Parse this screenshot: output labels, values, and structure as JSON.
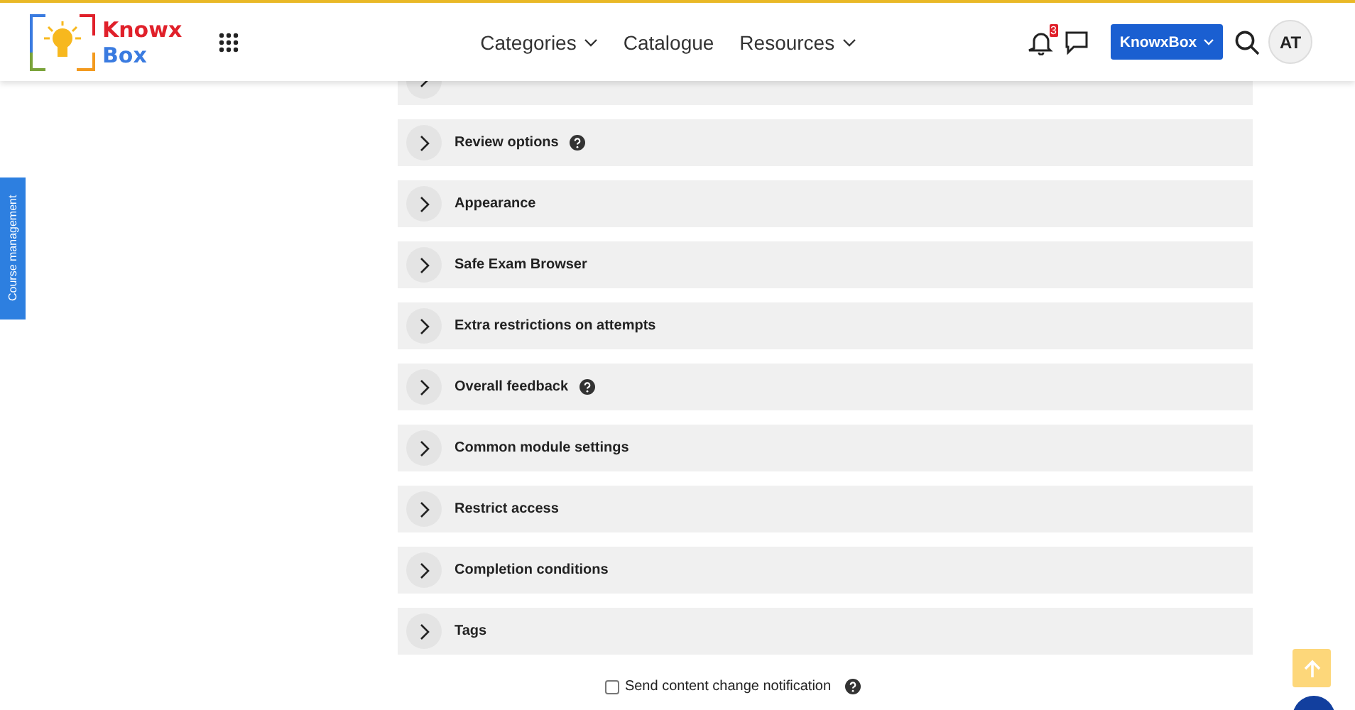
{
  "header": {
    "logo": {
      "line_1": "Knowx",
      "line_2": "Box"
    },
    "nav": [
      {
        "label": "Categories",
        "dropdown": true
      },
      {
        "label": "Catalogue",
        "dropdown": false
      },
      {
        "label": "Resources",
        "dropdown": true
      }
    ],
    "notifications": {
      "count": "3"
    },
    "account_button": {
      "label": "KnowxBox"
    },
    "avatar": {
      "initials": "AT"
    }
  },
  "side_tab": {
    "label": "Course management"
  },
  "sections": [
    {
      "expanded": false,
      "help": false
    },
    {
      "title": "Review options",
      "expanded": false,
      "help": true
    },
    {
      "title": "Appearance",
      "expanded": false,
      "help": false
    },
    {
      "title": "Safe Exam Browser",
      "expanded": false,
      "help": false
    },
    {
      "title": "Extra restrictions on attempts",
      "expanded": false,
      "help": false
    },
    {
      "title": "Overall feedback",
      "expanded": false,
      "help": true
    },
    {
      "title": "Common module settings",
      "expanded": false,
      "help": false
    },
    {
      "title": "Restrict access",
      "expanded": false,
      "help": false
    },
    {
      "title": "Completion conditions",
      "expanded": false,
      "help": false
    },
    {
      "title": "Tags",
      "expanded": false,
      "help": false
    }
  ],
  "notification_option": {
    "label": "Send content change notification",
    "checked": false,
    "help": true
  }
}
